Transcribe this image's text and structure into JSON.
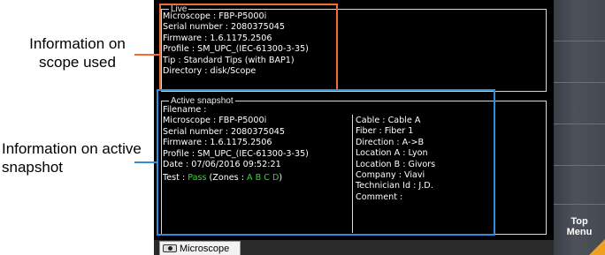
{
  "callouts": {
    "live": "Information on scope used",
    "snapshot": "Information on active snapshot"
  },
  "live": {
    "title": "Live",
    "lines": [
      "Microscope : FBP-P5000i",
      "Serial number : 2080375045",
      "Firmware : 1.6.1175.2506",
      "Profile : SM_UPC_(IEC-61300-3-35)",
      "Tip : Standard Tips (with BAP1)",
      "Directory : disk/Scope"
    ]
  },
  "snapshot": {
    "title": "Active snapshot",
    "left_lines": [
      "Filename :",
      "Microscope : FBP-P5000i",
      "Serial number : 2080375045",
      "Firmware : 1.6.1175.2506",
      "Profile : SM_UPC_(IEC-61300-3-35)",
      "Date : 07/06/2016 09:52:21"
    ],
    "test": {
      "prefix": "Test : ",
      "result": "Pass",
      "zones_prefix": " (Zones : ",
      "zones": "A B C D",
      "zones_suffix": ")"
    },
    "right_lines": [
      "Cable : Cable A",
      "Fiber : Fiber 1",
      "Direction : A->B",
      "Location A : Lyon",
      "Location B : Givors",
      "Company : Viavi",
      "Technician Id : J.D.",
      "Comment :"
    ]
  },
  "statusbar": {
    "tab_label": "Microscope"
  },
  "side_menu": {
    "top_menu_line1": "Top",
    "top_menu_line2": "Menu"
  },
  "colors": {
    "live_highlight": "#f26a3a",
    "snapshot_highlight": "#2d8be0",
    "pass": "#27e027",
    "accent": "#f0a020"
  },
  "icons": {
    "tab_icon": "microscope-icon"
  }
}
